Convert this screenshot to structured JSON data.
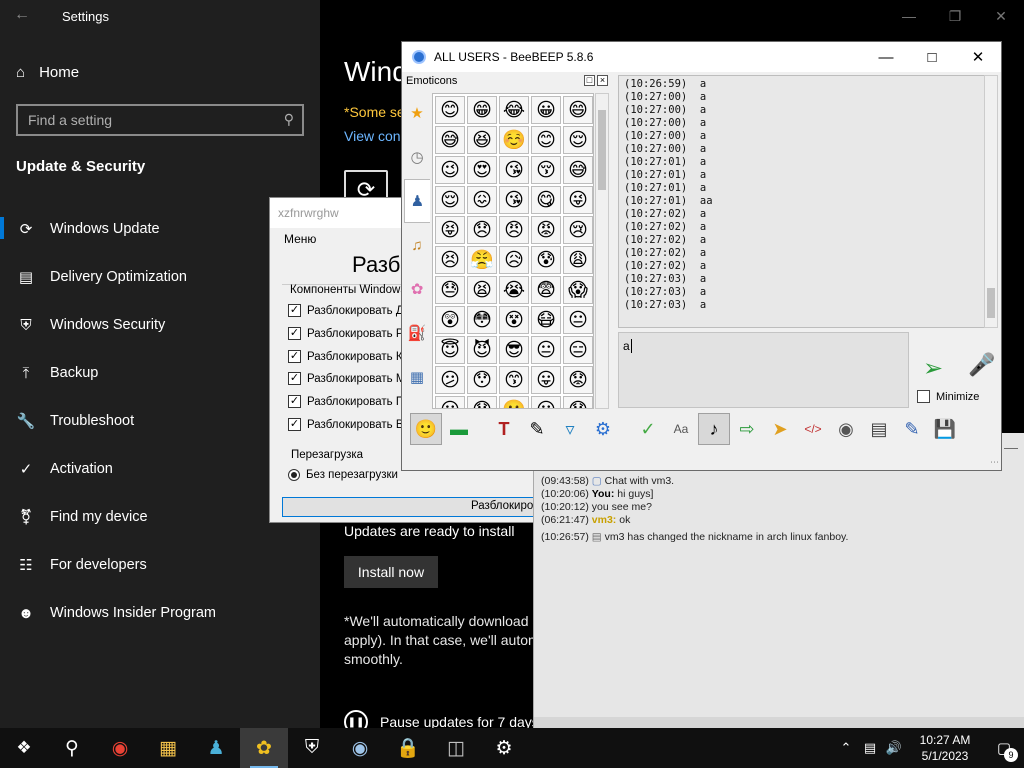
{
  "settings": {
    "title": "Settings",
    "home": "Home",
    "search_placeholder": "Find a setting",
    "section": "Update & Security",
    "nav": [
      {
        "label": "Windows Update",
        "icon": "sync-icon"
      },
      {
        "label": "Delivery Optimization",
        "icon": "delivery-icon"
      },
      {
        "label": "Windows Security",
        "icon": "shield-icon"
      },
      {
        "label": "Backup",
        "icon": "backup-icon"
      },
      {
        "label": "Troubleshoot",
        "icon": "wrench-icon"
      },
      {
        "label": "Activation",
        "icon": "check-circle-icon"
      },
      {
        "label": "Find my device",
        "icon": "person-pin-icon"
      },
      {
        "label": "For developers",
        "icon": "dev-icon"
      },
      {
        "label": "Windows Insider Program",
        "icon": "insider-icon"
      }
    ],
    "main": {
      "heading": "Wind",
      "note": "*Some se",
      "link": "View con",
      "ready": "Updates are ready to install",
      "install_button": "Install now",
      "auto_note": "*We'll automatically download and install updates, except on metered connections (where charges may apply). In that case, we'll automatically download only those updates required to keep Windows running smoothly.",
      "pause": "Pause updates for 7 days"
    }
  },
  "tool": {
    "title": "xzfnrwrghw",
    "menu": "Меню",
    "big_label": "Разб",
    "group_label": "Компоненты Windows",
    "checkboxes": [
      "Разблокировать Д",
      "Разблокировать Р",
      "Разблокировать К",
      "Разблокировать М",
      "Разблокировать П",
      "Разблокировать В"
    ],
    "restart_label": "Перезагрузка",
    "radio": "Без перезагрузки",
    "button": "Разблокиро"
  },
  "bee2": {
    "lines": [
      {
        "time": "(09:43:58)",
        "who": "",
        "text": "Chat with vm3."
      },
      {
        "time": "(10:20:06)",
        "who": "You:",
        "text": "hi guys]"
      },
      {
        "time": "(10:20:12)",
        "who": "",
        "text": "you see me?"
      },
      {
        "time": "(06:21:47)",
        "who": "vm3:",
        "text": "ok"
      },
      {
        "time": "(10:26:57)",
        "who": "",
        "text": "vm3 has changed the nickname in arch linux fanboy."
      }
    ]
  },
  "bee": {
    "title": "ALL USERS - BeeBEEP 5.8.6",
    "emoticons_label": "Emoticons",
    "emoji": [
      "😊",
      "😁",
      "😂",
      "😀",
      "😄",
      "😅",
      "😆",
      "☺️",
      "😊",
      "😌",
      "😉",
      "😍",
      "😘",
      "😚",
      "😅",
      "😌",
      "😖",
      "😘",
      "😋",
      "😜",
      "😝",
      "😞",
      "😠",
      "😡",
      "😢",
      "😣",
      "😤",
      "😥",
      "😰",
      "😩",
      "😓",
      "😫",
      "😭",
      "😨",
      "😱",
      "😲",
      "😳",
      "😵",
      "😷",
      "😐",
      "😇",
      "😈",
      "😎",
      "😐",
      "😑",
      "😕",
      "😯",
      "😙",
      "😛",
      "😟",
      "😦",
      "😧",
      "😬",
      "😮",
      "😯"
    ],
    "messages": [
      {
        "time": "(10:26:59)",
        "text": "a"
      },
      {
        "time": "(10:27:00)",
        "text": "a"
      },
      {
        "time": "(10:27:00)",
        "text": "a"
      },
      {
        "time": "(10:27:00)",
        "text": "a"
      },
      {
        "time": "(10:27:00)",
        "text": "a"
      },
      {
        "time": "(10:27:00)",
        "text": "a"
      },
      {
        "time": "(10:27:01)",
        "text": "a"
      },
      {
        "time": "(10:27:01)",
        "text": "a"
      },
      {
        "time": "(10:27:01)",
        "text": "a"
      },
      {
        "time": "(10:27:01)",
        "text": "aa"
      },
      {
        "time": "(10:27:02)",
        "text": "a"
      },
      {
        "time": "(10:27:02)",
        "text": "a"
      },
      {
        "time": "(10:27:02)",
        "text": "a"
      },
      {
        "time": "(10:27:02)",
        "text": "a"
      },
      {
        "time": "(10:27:02)",
        "text": "a"
      },
      {
        "time": "(10:27:03)",
        "text": "a"
      },
      {
        "time": "(10:27:03)",
        "text": "a"
      },
      {
        "time": "(10:27:03)",
        "text": "a"
      }
    ],
    "input_value": "a",
    "minimize_label": "Minimize"
  },
  "taskbar": {
    "time": "10:27 AM",
    "date": "5/1/2023",
    "notifications": "9"
  }
}
